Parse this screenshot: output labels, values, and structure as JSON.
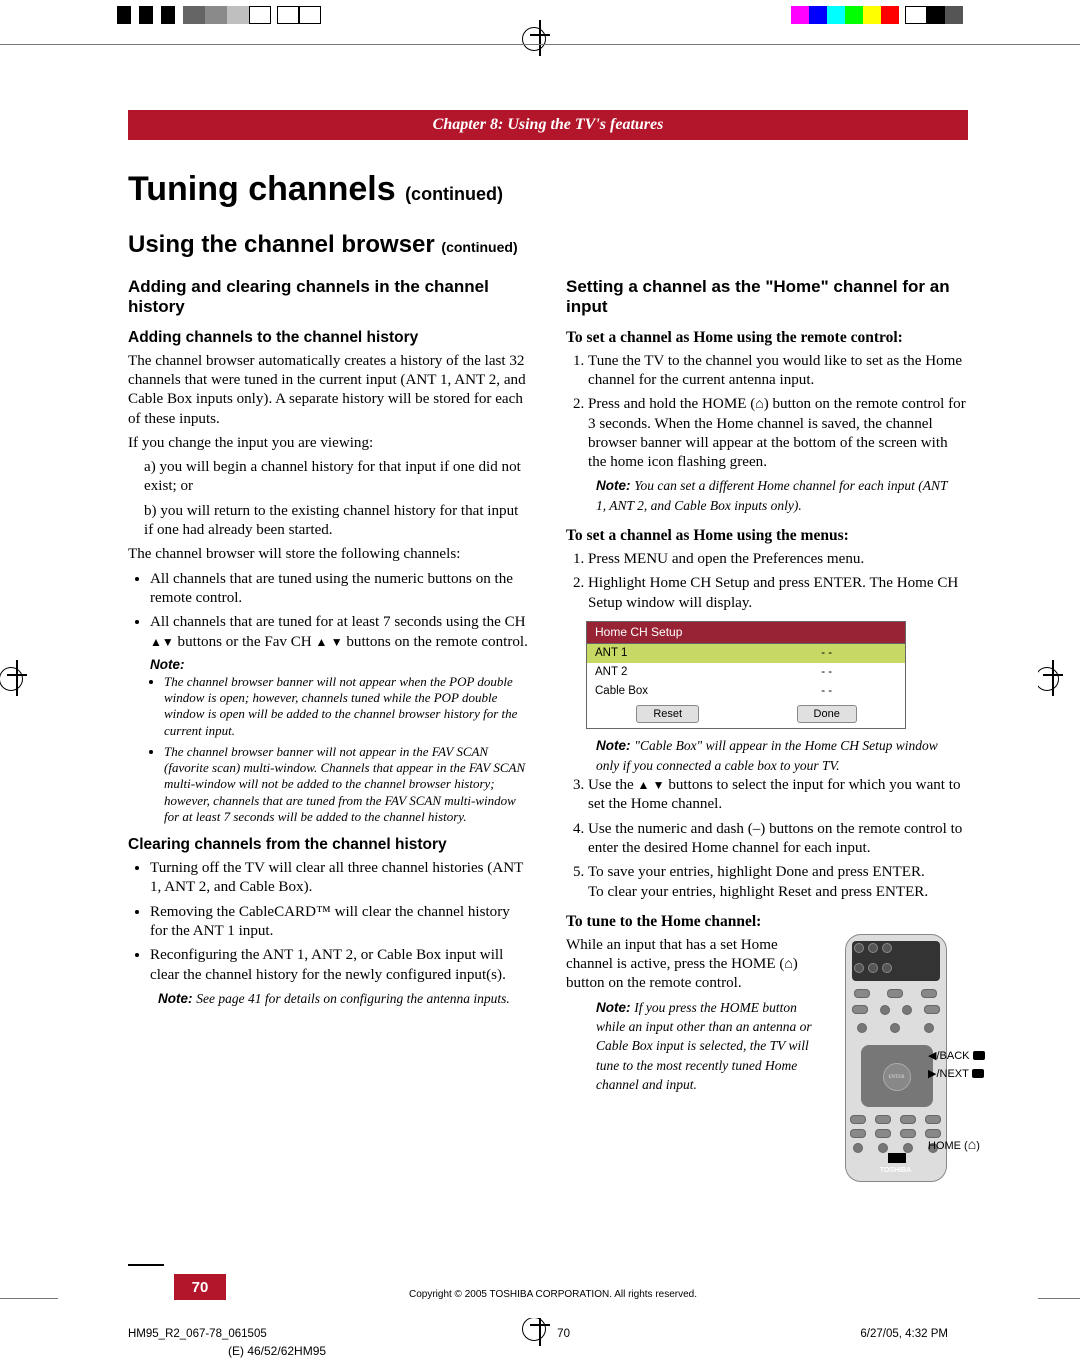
{
  "header": {
    "chapter": "Chapter 8: Using the TV's features"
  },
  "titles": {
    "main": "Tuning channels",
    "main_cont": "(continued)",
    "sub": "Using the channel browser",
    "sub_cont": "(continued)"
  },
  "left": {
    "h3a": "Adding and clearing channels in the channel history",
    "h4a": "Adding channels to the channel history",
    "p1": "The channel browser automatically creates a history of the last 32 channels that were tuned in the current input (ANT 1, ANT 2, and Cable Box inputs only). A separate history will be stored for each of these inputs.",
    "p2": "If you change the input you are viewing:",
    "li_a": "a)  you will begin a channel history for that input if one did not exist; or",
    "li_b": "b)  you will return to the existing channel history for that input if one had already been started.",
    "p3": "The channel browser will store the following channels:",
    "b1": "All channels that are tuned using the numeric buttons on the remote control.",
    "b2a": "All channels that are tuned for at least 7 seconds using the CH ",
    "b2b": " buttons or the Fav CH ",
    "b2c": " buttons on the remote control.",
    "note_label": "Note:",
    "note1_b1": "The channel browser banner will not appear when the POP double window is open; however, channels tuned while the POP double window is open will be added to the channel browser history for the current input.",
    "note1_b2": "The channel browser banner will not appear in the FAV SCAN (favorite scan) multi-window. Channels that appear in the FAV SCAN multi-window will not be added to the channel browser history; however, channels that are tuned from the FAV SCAN multi-window for at least 7 seconds will be added to the channel history.",
    "h4b": "Clearing channels from the channel history",
    "c1": "Turning off the TV will clear all three channel histories (ANT 1, ANT 2, and Cable Box).",
    "c2": "Removing the CableCARD™ will clear the channel history for the ANT 1 input.",
    "c3": "Reconfiguring the ANT 1, ANT 2, or Cable Box input will clear the channel history for the newly configured input(s).",
    "note2_label": "Note:",
    "note2_body": " See page 41 for details on configuring the antenna inputs."
  },
  "right": {
    "h3a": "Setting a channel as the \"Home\" channel for an input",
    "h4a": "To set a channel as Home using the remote control:",
    "o1": "Tune the TV to the channel you would like to set as the Home channel for the current antenna input.",
    "o2a": "Press and hold the HOME (",
    "o2b": ") button on the remote control for 3 seconds. When the Home channel is saved, the channel browser banner will appear at the bottom of the screen with the home icon flashing green.",
    "note3_label": "Note:",
    "note3_body": " You can set a different Home channel for each input (ANT 1, ANT 2, and Cable Box inputs only).",
    "h4b": "To set a channel as Home using the menus:",
    "m1": "Press MENU and open the Preferences menu.",
    "m2": "Highlight Home CH Setup and press ENTER.  The Home CH Setup window will display.",
    "setup": {
      "title": "Home CH Setup",
      "rows": [
        {
          "label": "ANT 1",
          "val": "- -"
        },
        {
          "label": "ANT 2",
          "val": "- -"
        },
        {
          "label": "Cable Box",
          "val": "- -"
        }
      ],
      "btn_reset": "Reset",
      "btn_done": "Done"
    },
    "note4_label": "Note:",
    "note4_body": " \"Cable Box\" will appear in the Home CH Setup window only if you connected a cable box to your TV.",
    "m3a": "Use the ",
    "m3b": " buttons to select the input for which you want to set the Home channel.",
    "m4": "Use the numeric and dash (–) buttons on the remote control to enter the desired Home channel for each input.",
    "m5a": "To save your entries, highlight Done and press ENTER.",
    "m5b": "To clear your entries, highlight Reset and press ENTER.",
    "h4c": "To tune to the Home channel:",
    "p4a": "While an input that has a set Home channel is active, press the HOME (",
    "p4b": ") button on the remote control.",
    "note5_label": "Note:",
    "note5_body": " If you press the HOME button while an input other than an antenna or Cable Box input is selected, the TV will tune to the most recently tuned Home channel and input.",
    "callouts": {
      "back": "/BACK",
      "next": "/NEXT",
      "home": "HOME ("
    }
  },
  "chart_data": {
    "type": "table",
    "title": "Home CH Setup",
    "categories": [
      "ANT 1",
      "ANT 2",
      "Cable Box"
    ],
    "values": [
      "- -",
      "- -",
      "- -"
    ]
  },
  "footer": {
    "page_num": "70",
    "copyright": "Copyright © 2005 TOSHIBA CORPORATION. All rights reserved.",
    "bleed_left": "HM95_R2_067-78_061505",
    "bleed_mid": "70",
    "bleed_right": "6/27/05, 4:32 PM",
    "model": "(E) 46/52/62HM95"
  }
}
